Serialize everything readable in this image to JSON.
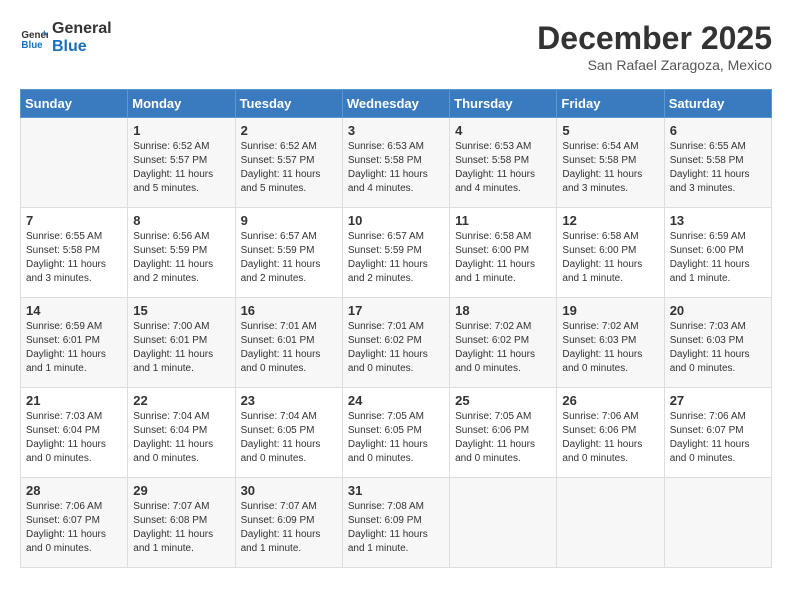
{
  "logo": {
    "line1": "General",
    "line2": "Blue"
  },
  "title": "December 2025",
  "location": "San Rafael Zaragoza, Mexico",
  "days_of_week": [
    "Sunday",
    "Monday",
    "Tuesday",
    "Wednesday",
    "Thursday",
    "Friday",
    "Saturday"
  ],
  "weeks": [
    [
      {
        "day": "",
        "info": ""
      },
      {
        "day": "1",
        "info": "Sunrise: 6:52 AM\nSunset: 5:57 PM\nDaylight: 11 hours\nand 5 minutes."
      },
      {
        "day": "2",
        "info": "Sunrise: 6:52 AM\nSunset: 5:57 PM\nDaylight: 11 hours\nand 5 minutes."
      },
      {
        "day": "3",
        "info": "Sunrise: 6:53 AM\nSunset: 5:58 PM\nDaylight: 11 hours\nand 4 minutes."
      },
      {
        "day": "4",
        "info": "Sunrise: 6:53 AM\nSunset: 5:58 PM\nDaylight: 11 hours\nand 4 minutes."
      },
      {
        "day": "5",
        "info": "Sunrise: 6:54 AM\nSunset: 5:58 PM\nDaylight: 11 hours\nand 3 minutes."
      },
      {
        "day": "6",
        "info": "Sunrise: 6:55 AM\nSunset: 5:58 PM\nDaylight: 11 hours\nand 3 minutes."
      }
    ],
    [
      {
        "day": "7",
        "info": "Sunrise: 6:55 AM\nSunset: 5:58 PM\nDaylight: 11 hours\nand 3 minutes."
      },
      {
        "day": "8",
        "info": "Sunrise: 6:56 AM\nSunset: 5:59 PM\nDaylight: 11 hours\nand 2 minutes."
      },
      {
        "day": "9",
        "info": "Sunrise: 6:57 AM\nSunset: 5:59 PM\nDaylight: 11 hours\nand 2 minutes."
      },
      {
        "day": "10",
        "info": "Sunrise: 6:57 AM\nSunset: 5:59 PM\nDaylight: 11 hours\nand 2 minutes."
      },
      {
        "day": "11",
        "info": "Sunrise: 6:58 AM\nSunset: 6:00 PM\nDaylight: 11 hours\nand 1 minute."
      },
      {
        "day": "12",
        "info": "Sunrise: 6:58 AM\nSunset: 6:00 PM\nDaylight: 11 hours\nand 1 minute."
      },
      {
        "day": "13",
        "info": "Sunrise: 6:59 AM\nSunset: 6:00 PM\nDaylight: 11 hours\nand 1 minute."
      }
    ],
    [
      {
        "day": "14",
        "info": "Sunrise: 6:59 AM\nSunset: 6:01 PM\nDaylight: 11 hours\nand 1 minute."
      },
      {
        "day": "15",
        "info": "Sunrise: 7:00 AM\nSunset: 6:01 PM\nDaylight: 11 hours\nand 1 minute."
      },
      {
        "day": "16",
        "info": "Sunrise: 7:01 AM\nSunset: 6:01 PM\nDaylight: 11 hours\nand 0 minutes."
      },
      {
        "day": "17",
        "info": "Sunrise: 7:01 AM\nSunset: 6:02 PM\nDaylight: 11 hours\nand 0 minutes."
      },
      {
        "day": "18",
        "info": "Sunrise: 7:02 AM\nSunset: 6:02 PM\nDaylight: 11 hours\nand 0 minutes."
      },
      {
        "day": "19",
        "info": "Sunrise: 7:02 AM\nSunset: 6:03 PM\nDaylight: 11 hours\nand 0 minutes."
      },
      {
        "day": "20",
        "info": "Sunrise: 7:03 AM\nSunset: 6:03 PM\nDaylight: 11 hours\nand 0 minutes."
      }
    ],
    [
      {
        "day": "21",
        "info": "Sunrise: 7:03 AM\nSunset: 6:04 PM\nDaylight: 11 hours\nand 0 minutes."
      },
      {
        "day": "22",
        "info": "Sunrise: 7:04 AM\nSunset: 6:04 PM\nDaylight: 11 hours\nand 0 minutes."
      },
      {
        "day": "23",
        "info": "Sunrise: 7:04 AM\nSunset: 6:05 PM\nDaylight: 11 hours\nand 0 minutes."
      },
      {
        "day": "24",
        "info": "Sunrise: 7:05 AM\nSunset: 6:05 PM\nDaylight: 11 hours\nand 0 minutes."
      },
      {
        "day": "25",
        "info": "Sunrise: 7:05 AM\nSunset: 6:06 PM\nDaylight: 11 hours\nand 0 minutes."
      },
      {
        "day": "26",
        "info": "Sunrise: 7:06 AM\nSunset: 6:06 PM\nDaylight: 11 hours\nand 0 minutes."
      },
      {
        "day": "27",
        "info": "Sunrise: 7:06 AM\nSunset: 6:07 PM\nDaylight: 11 hours\nand 0 minutes."
      }
    ],
    [
      {
        "day": "28",
        "info": "Sunrise: 7:06 AM\nSunset: 6:07 PM\nDaylight: 11 hours\nand 0 minutes."
      },
      {
        "day": "29",
        "info": "Sunrise: 7:07 AM\nSunset: 6:08 PM\nDaylight: 11 hours\nand 1 minute."
      },
      {
        "day": "30",
        "info": "Sunrise: 7:07 AM\nSunset: 6:09 PM\nDaylight: 11 hours\nand 1 minute."
      },
      {
        "day": "31",
        "info": "Sunrise: 7:08 AM\nSunset: 6:09 PM\nDaylight: 11 hours\nand 1 minute."
      },
      {
        "day": "",
        "info": ""
      },
      {
        "day": "",
        "info": ""
      },
      {
        "day": "",
        "info": ""
      }
    ]
  ]
}
